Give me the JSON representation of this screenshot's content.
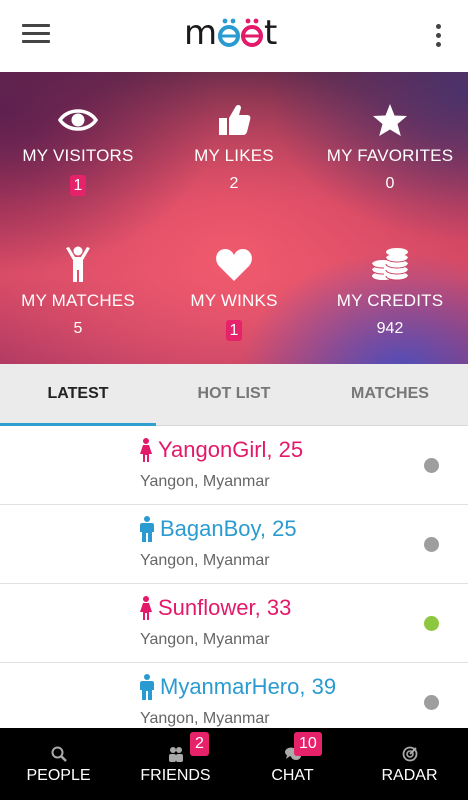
{
  "app": {
    "logo_text": "meet"
  },
  "stats": [
    {
      "icon": "eye-icon",
      "label": "MY VISITORS",
      "value": "1",
      "badge": true
    },
    {
      "icon": "thumbs-up-icon",
      "label": "MY LIKES",
      "value": "2",
      "badge": false
    },
    {
      "icon": "star-icon",
      "label": "MY FAVORITES",
      "value": "0",
      "badge": false
    },
    {
      "icon": "person-arms-up-icon",
      "label": "MY MATCHES",
      "value": "5",
      "badge": false
    },
    {
      "icon": "heart-icon",
      "label": "MY WINKS",
      "value": "1",
      "badge": true
    },
    {
      "icon": "coins-icon",
      "label": "MY CREDITS",
      "value": "942",
      "badge": false
    }
  ],
  "tabs": [
    {
      "label": "LATEST",
      "active": true
    },
    {
      "label": "HOT LIST",
      "active": false
    },
    {
      "label": "MATCHES",
      "active": false
    }
  ],
  "users": [
    {
      "name": "YangonGirl, 25",
      "location": "Yangon, Myanmar",
      "gender": "female",
      "status_color": "#9e9e9e"
    },
    {
      "name": "BaganBoy, 25",
      "location": "Yangon, Myanmar",
      "gender": "male",
      "status_color": "#9e9e9e"
    },
    {
      "name": "Sunflower, 33",
      "location": "Yangon, Myanmar",
      "gender": "female",
      "status_color": "#8dc63f"
    },
    {
      "name": "MyanmarHero, 39",
      "location": "Yangon, Myanmar",
      "gender": "male",
      "status_color": "#9e9e9e"
    }
  ],
  "bottom_nav": [
    {
      "icon": "search-icon",
      "label": "PEOPLE",
      "badge": ""
    },
    {
      "icon": "friends-icon",
      "label": "FRIENDS",
      "badge": "2"
    },
    {
      "icon": "chat-bubbles-icon",
      "label": "CHAT",
      "badge": "10"
    },
    {
      "icon": "radar-icon",
      "label": "RADAR",
      "badge": ""
    }
  ],
  "colors": {
    "accent_pink": "#e3196a",
    "accent_blue": "#2a9bd0",
    "online": "#8dc63f",
    "offline": "#9e9e9e"
  }
}
